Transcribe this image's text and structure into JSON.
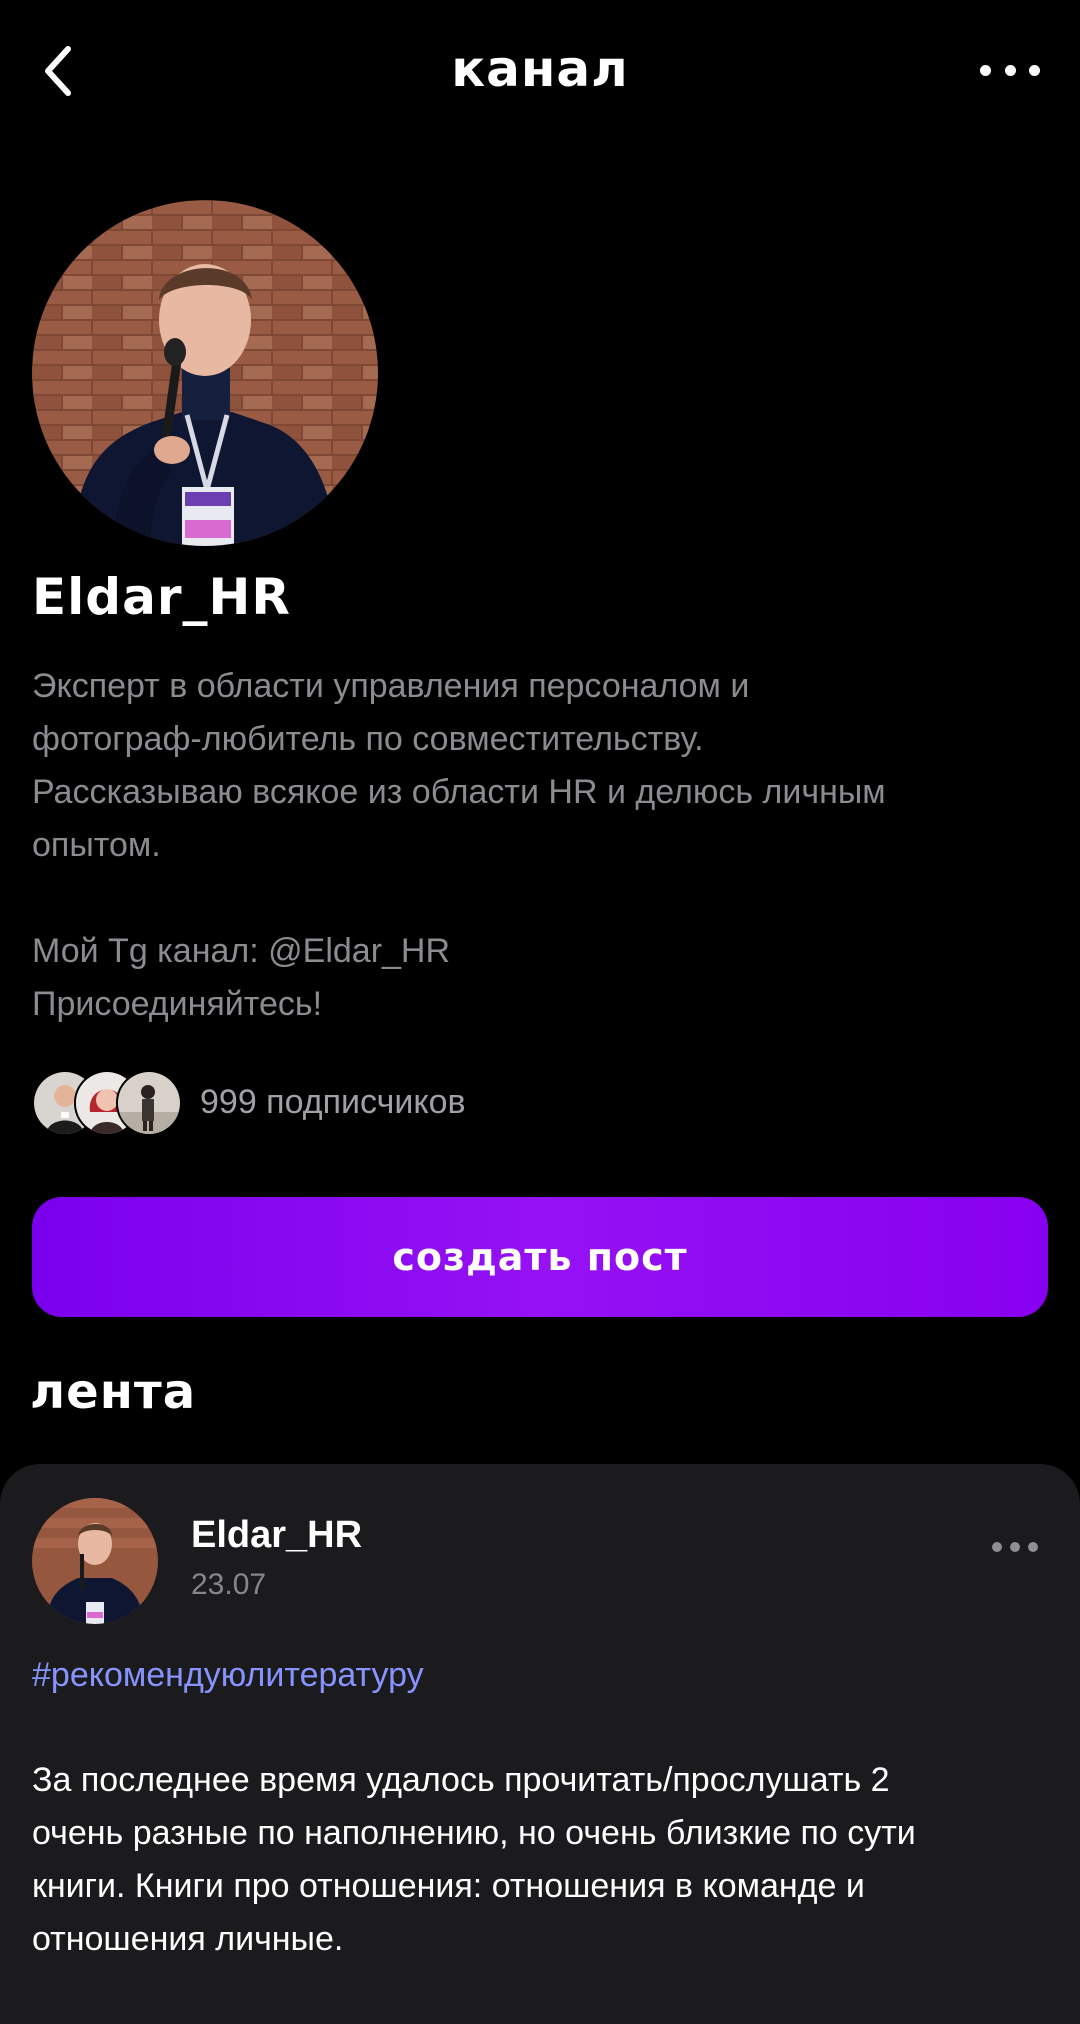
{
  "topbar": {
    "title": "канал",
    "back_icon": "chevron-left-icon",
    "more_icon": "more-horizontal-icon"
  },
  "channel": {
    "name": "Eldar_HR",
    "bio_lines": [
      "Эксперт в области управления персоналом и",
      "фотограф-любитель по совместительству.",
      "Рассказываю всякое из области HR и делюсь личным",
      "опытом."
    ],
    "bio_lines_2": [
      "Мой Tg канал: @Eldar_HR",
      "Присоединяйтесь!"
    ],
    "subscribers_text": "999 подписчиков"
  },
  "actions": {
    "create_post_label": "создать пост"
  },
  "feed": {
    "title": "лента",
    "posts": [
      {
        "author": "Eldar_HR",
        "date": "23.07",
        "tag": "#рекомендуюлитературу",
        "text_lines": [
          "За последнее время удалось прочитать/прослушать 2",
          "очень разные по наполнению, но очень близкие по сути",
          "книги. Книги про отношения: отношения в команде и",
          "отношения личные."
        ]
      }
    ]
  },
  "colors": {
    "background": "#000000",
    "accent_gradient_start": "#7a00ee",
    "accent_gradient_end": "#9611f4",
    "secondary_text": "#8b8b90",
    "tag": "#8794ff",
    "card": "#1b1b1e"
  }
}
